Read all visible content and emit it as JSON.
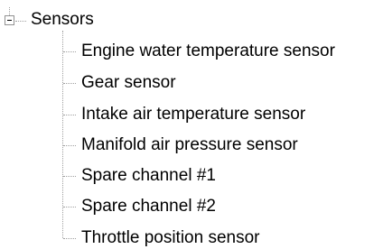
{
  "tree": {
    "root": {
      "label": "Sensors",
      "expanded": true,
      "expander_icon": "minus-box-icon"
    },
    "children": [
      {
        "label": "Engine water temperature sensor"
      },
      {
        "label": "Gear sensor"
      },
      {
        "label": "Intake air temperature sensor"
      },
      {
        "label": "Manifold air pressure sensor"
      },
      {
        "label": "Spare channel #1"
      },
      {
        "label": "Spare channel #2"
      },
      {
        "label": "Throttle position sensor"
      }
    ]
  },
  "colors": {
    "background": "#ffffff",
    "text": "#000000",
    "connector": "#a0a0a0",
    "expander_border": "#919191"
  }
}
